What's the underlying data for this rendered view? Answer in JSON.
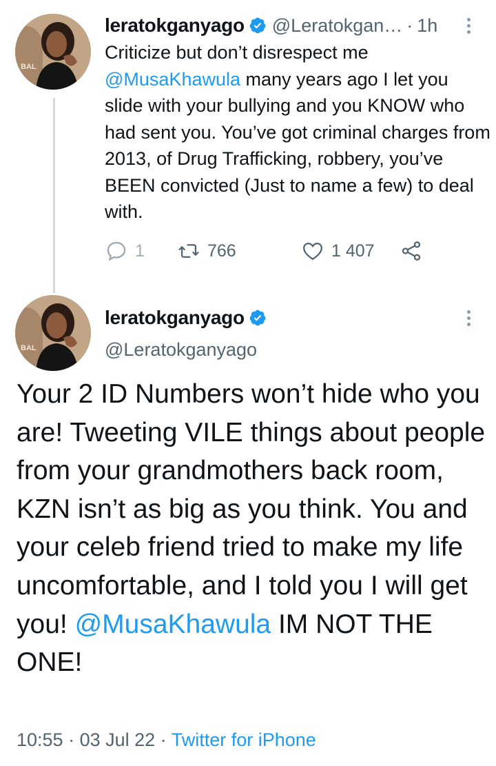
{
  "tweet1": {
    "display_name": "leratokganyago",
    "handle": "@Leratokgan…",
    "separator": "·",
    "time": "1h",
    "text_a": "Criticize but don’t disrespect me",
    "mention": "@MusaKhawula",
    "text_b": " many years ago I let you slide with your bullying and you KNOW who had sent you. You’ve got criminal charges from 2013,  of Drug Trafficking, robbery, you’ve BEEN convicted (Just to name a few) to deal with.",
    "reply_count": "1",
    "retweet_count": "766",
    "like_count": "1 407",
    "avatar_logo_text": "BAL"
  },
  "tweet2": {
    "display_name": "leratokganyago",
    "handle": "@Leratokganyago",
    "text_a": "Your 2 ID Numbers won’t hide who you are! Tweeting VILE things about people from your grandmothers back room, KZN isn’t as big as you think. You and your celeb friend tried to make my life uncomfortable, and I told you I will get you!  ",
    "mention": "@MusaKhawula",
    "text_b": " IM NOT THE ONE!",
    "time": "10:55",
    "date": "03 Jul 22",
    "source": "Twitter for iPhone",
    "separator": " · ",
    "avatar_logo_text": "BAL"
  },
  "colors": {
    "accent": "#1d9bf0",
    "secondary_text": "#536471",
    "primary_text": "#0f1419",
    "thread_line": "#cfd9de"
  },
  "icons": {
    "verified": "verified-badge-icon",
    "reply": "reply-icon",
    "retweet": "retweet-icon",
    "like": "heart-icon",
    "share": "share-icon",
    "more": "more-vertical-icon"
  }
}
